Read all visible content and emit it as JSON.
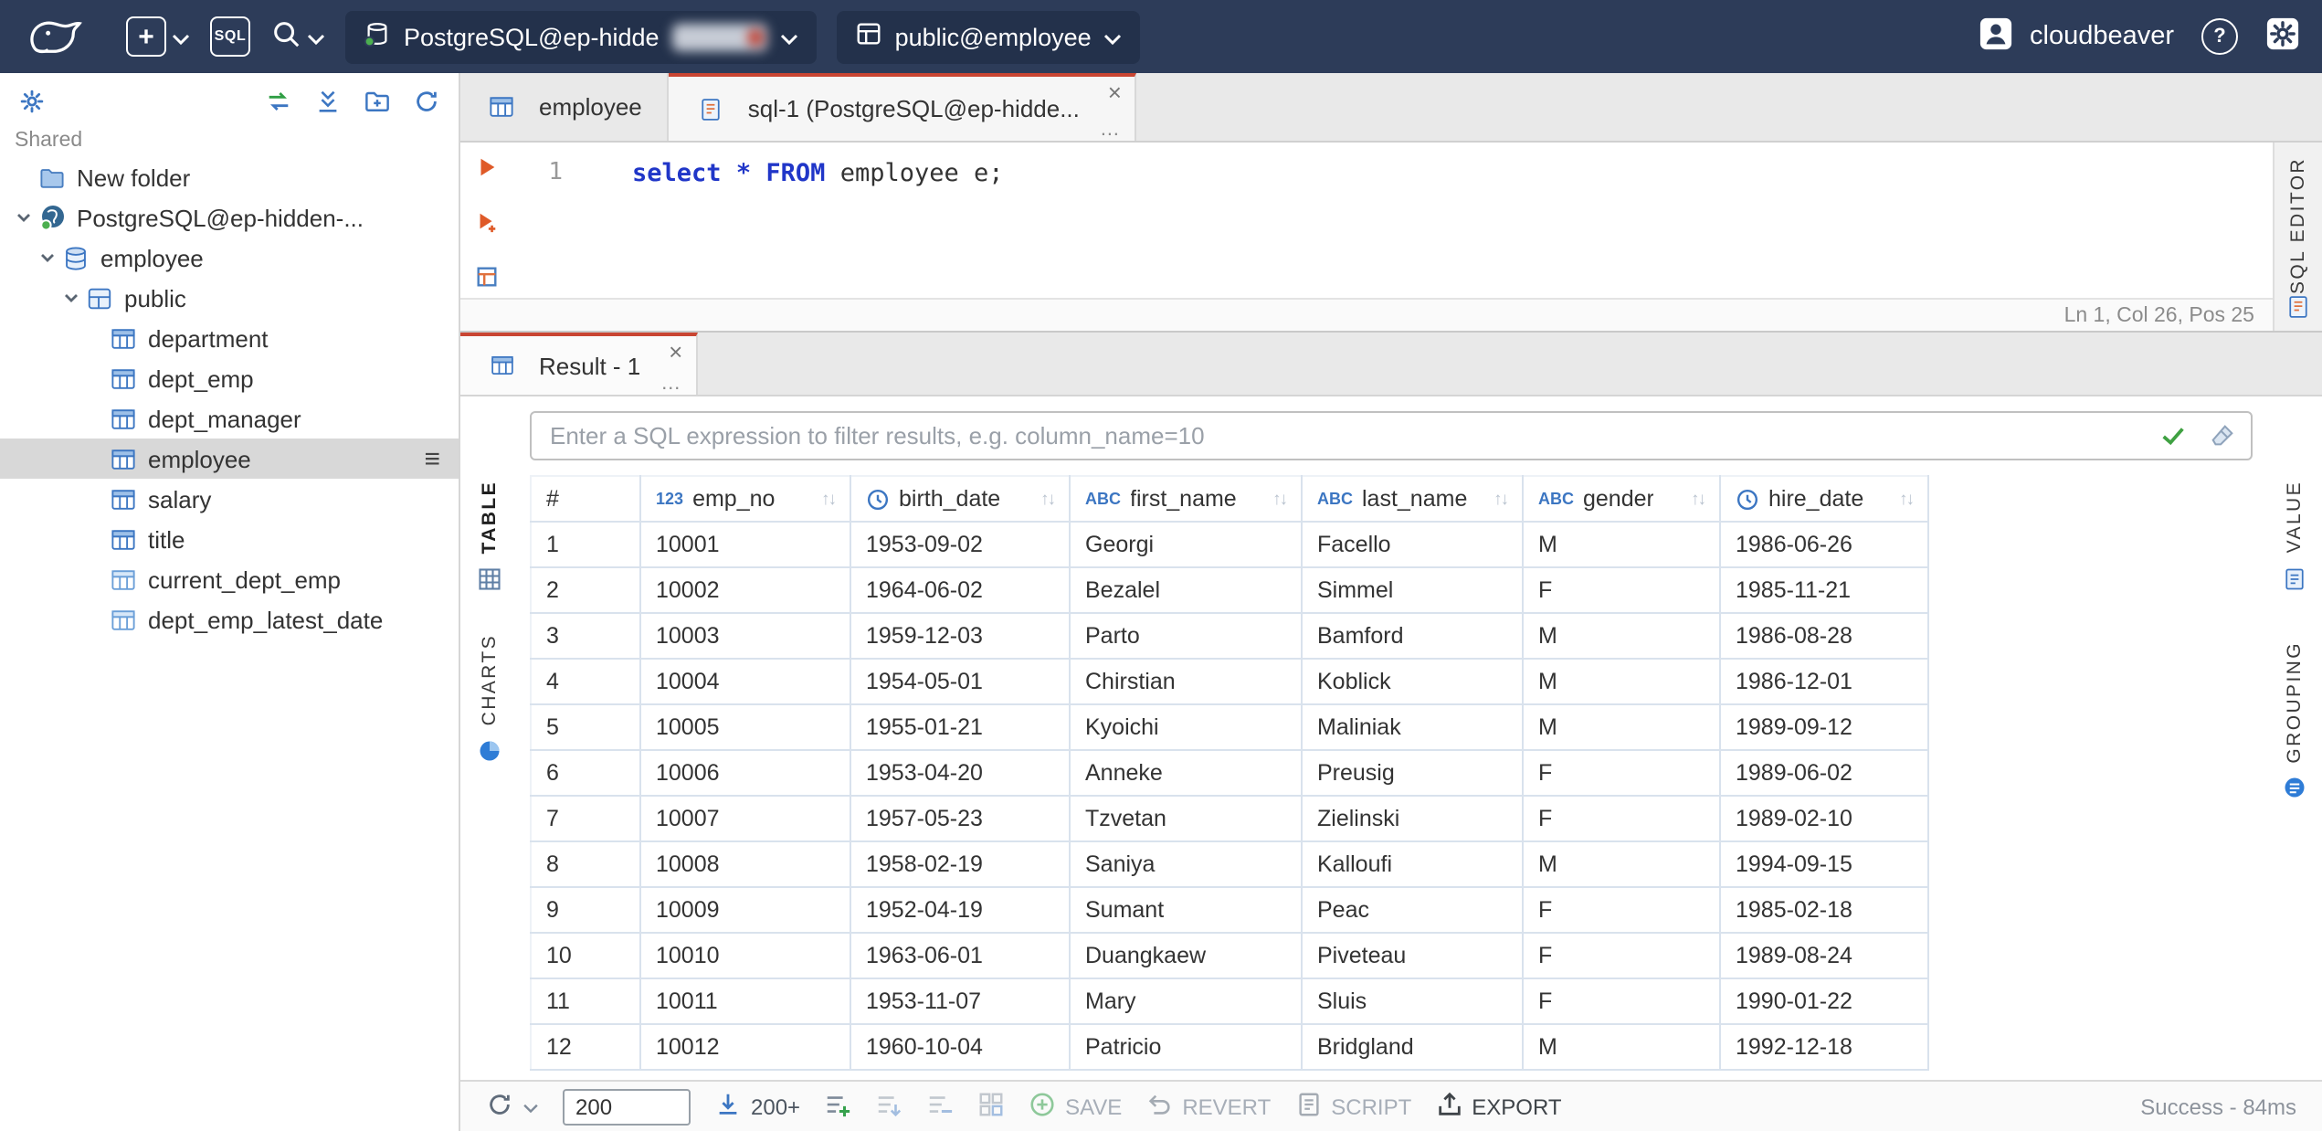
{
  "glyphs": {
    "close": "×",
    "menu_dots": "…",
    "menu": "≡",
    "sort": "↑↓",
    "plus": "+",
    "question": "?"
  },
  "topbar": {
    "new_label": "+",
    "sql_label": "SQL",
    "connection_label": "PostgreSQL@ep-hidde",
    "schema_label": "public@employee",
    "user_label": "cloudbeaver",
    "help_label": "?"
  },
  "sidebar": {
    "section_label": "Shared",
    "tree": [
      {
        "label": "New folder",
        "icon": "folder",
        "level": 0,
        "expanded": false,
        "selected": false
      },
      {
        "label": "PostgreSQL@ep-hidden-...",
        "icon": "postgres",
        "level": 0,
        "expanded": true,
        "selected": false
      },
      {
        "label": "employee",
        "icon": "database",
        "level": 1,
        "expanded": true,
        "selected": false
      },
      {
        "label": "public",
        "icon": "schema",
        "level": 2,
        "expanded": true,
        "selected": false
      },
      {
        "label": "department",
        "icon": "table",
        "level": 3,
        "expanded": false,
        "selected": false
      },
      {
        "label": "dept_emp",
        "icon": "table",
        "level": 3,
        "expanded": false,
        "selected": false
      },
      {
        "label": "dept_manager",
        "icon": "table",
        "level": 3,
        "expanded": false,
        "selected": false
      },
      {
        "label": "employee",
        "icon": "table",
        "level": 3,
        "expanded": false,
        "selected": true
      },
      {
        "label": "salary",
        "icon": "table",
        "level": 3,
        "expanded": false,
        "selected": false
      },
      {
        "label": "title",
        "icon": "table",
        "level": 3,
        "expanded": false,
        "selected": false
      },
      {
        "label": "current_dept_emp",
        "icon": "view",
        "level": 3,
        "expanded": false,
        "selected": false
      },
      {
        "label": "dept_emp_latest_date",
        "icon": "view",
        "level": 3,
        "expanded": false,
        "selected": false
      }
    ]
  },
  "tabs": [
    {
      "label": "employee",
      "active": false
    },
    {
      "label": "sql-1 (PostgreSQL@ep-hidde...",
      "active": true
    }
  ],
  "editor": {
    "line_number": "1",
    "tokens": [
      {
        "text": "select",
        "type": "keyword"
      },
      {
        "text": " ",
        "type": "plain"
      },
      {
        "text": "*",
        "type": "keyword"
      },
      {
        "text": " ",
        "type": "plain"
      },
      {
        "text": "FROM",
        "type": "keyword"
      },
      {
        "text": " employee e;",
        "type": "plain"
      }
    ],
    "status": "Ln 1, Col 26, Pos 25",
    "side_tab": "SQL EDITOR"
  },
  "result": {
    "tab_label": "Result - 1",
    "filter_placeholder": "Enter a SQL expression to filter results, e.g. column_name=10",
    "left_tabs": [
      {
        "label": "TABLE",
        "active": true
      },
      {
        "label": "CHARTS",
        "active": false
      }
    ],
    "right_tabs": [
      {
        "label": "VALUE"
      },
      {
        "label": "GROUPING"
      }
    ],
    "grid": {
      "type_marks": {
        "number": "123",
        "string": "ABC"
      },
      "columns": [
        {
          "label": "#",
          "type": "rownum"
        },
        {
          "label": "emp_no",
          "type": "number"
        },
        {
          "label": "birth_date",
          "type": "date"
        },
        {
          "label": "first_name",
          "type": "string"
        },
        {
          "label": "last_name",
          "type": "string"
        },
        {
          "label": "gender",
          "type": "string"
        },
        {
          "label": "hire_date",
          "type": "date"
        }
      ],
      "rows": [
        [
          "1",
          "10001",
          "1953-09-02",
          "Georgi",
          "Facello",
          "M",
          "1986-06-26"
        ],
        [
          "2",
          "10002",
          "1964-06-02",
          "Bezalel",
          "Simmel",
          "F",
          "1985-11-21"
        ],
        [
          "3",
          "10003",
          "1959-12-03",
          "Parto",
          "Bamford",
          "M",
          "1986-08-28"
        ],
        [
          "4",
          "10004",
          "1954-05-01",
          "Chirstian",
          "Koblick",
          "M",
          "1986-12-01"
        ],
        [
          "5",
          "10005",
          "1955-01-21",
          "Kyoichi",
          "Maliniak",
          "M",
          "1989-09-12"
        ],
        [
          "6",
          "10006",
          "1953-04-20",
          "Anneke",
          "Preusig",
          "F",
          "1989-06-02"
        ],
        [
          "7",
          "10007",
          "1957-05-23",
          "Tzvetan",
          "Zielinski",
          "F",
          "1989-02-10"
        ],
        [
          "8",
          "10008",
          "1958-02-19",
          "Saniya",
          "Kalloufi",
          "M",
          "1994-09-15"
        ],
        [
          "9",
          "10009",
          "1952-04-19",
          "Sumant",
          "Peac",
          "F",
          "1985-02-18"
        ],
        [
          "10",
          "10010",
          "1963-06-01",
          "Duangkaew",
          "Piveteau",
          "F",
          "1989-08-24"
        ],
        [
          "11",
          "10011",
          "1953-11-07",
          "Mary",
          "Sluis",
          "F",
          "1990-01-22"
        ],
        [
          "12",
          "10012",
          "1960-10-04",
          "Patricio",
          "Bridgland",
          "M",
          "1992-12-18"
        ]
      ]
    }
  },
  "footer": {
    "row_limit_value": "200",
    "fetch_label": "200+",
    "save_label": "SAVE",
    "revert_label": "REVERT",
    "script_label": "SCRIPT",
    "export_label": "EXPORT",
    "status": "Success - 84ms"
  }
}
